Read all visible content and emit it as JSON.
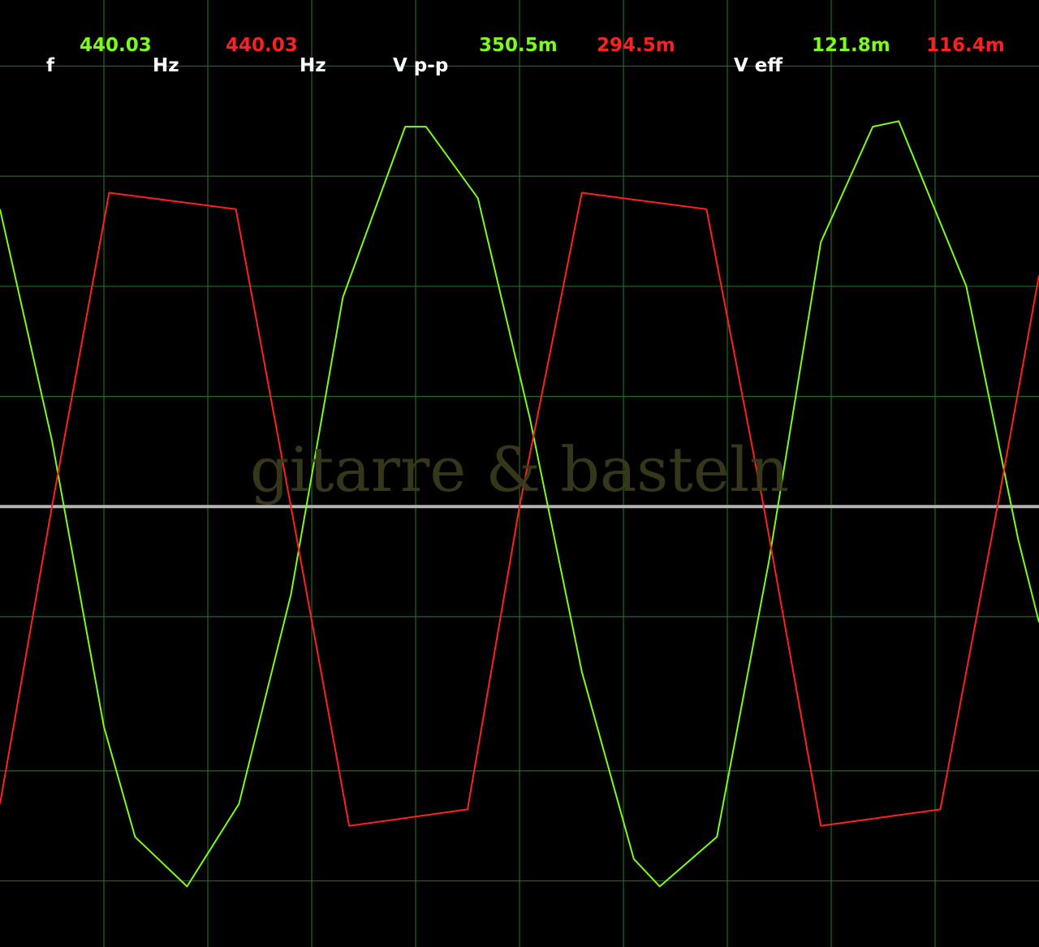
{
  "readouts": {
    "f_label": "f",
    "ch1_freq": "440.03",
    "ch1_unit": "Hz",
    "ch2_freq": "440.03",
    "ch2_unit": "Hz",
    "vpp_label": "V p-p",
    "ch1_vpp": "350.5m",
    "ch2_vpp": "294.5m",
    "veff_label": "V eff",
    "ch1_veff": "121.8m",
    "ch2_veff": "116.4m"
  },
  "watermark": "gitarre & basteln",
  "colors": {
    "background": "#000000",
    "grid": "#1f6a1f",
    "baseline": "#b4b4b4",
    "ch1": "#7cfc1a",
    "ch2": "#ff2020",
    "label": "#ffffff",
    "watermark": "#3c3c1e"
  },
  "chart_data": {
    "type": "line",
    "title": "",
    "xlabel": "",
    "ylabel": "",
    "grid": true,
    "xlim": [
      0,
      10
    ],
    "ylim": [
      -4,
      4.6
    ],
    "x_gridlines": [
      1,
      2,
      3,
      4,
      5,
      6,
      7,
      8,
      9
    ],
    "y_gridlines": [
      -3.4,
      -2.4,
      -1,
      0,
      1,
      2,
      3,
      4
    ],
    "series": [
      {
        "name": "",
        "color": "#7cfc1a",
        "points": [
          [
            0,
            2.7
          ],
          [
            0.5,
            0.6
          ],
          [
            1.0,
            -2.0
          ],
          [
            1.3,
            -3.0
          ],
          [
            1.8,
            -3.45
          ],
          [
            2.3,
            -2.7
          ],
          [
            2.8,
            -0.8
          ],
          [
            3.3,
            1.9
          ],
          [
            3.9,
            3.45
          ],
          [
            4.1,
            3.45
          ],
          [
            4.6,
            2.8
          ],
          [
            5.1,
            0.8
          ],
          [
            5.6,
            -1.5
          ],
          [
            6.1,
            -3.2
          ],
          [
            6.35,
            -3.45
          ],
          [
            6.9,
            -3.0
          ],
          [
            7.4,
            -0.5
          ],
          [
            7.9,
            2.4
          ],
          [
            8.4,
            3.45
          ],
          [
            8.65,
            3.5
          ],
          [
            9.3,
            2.0
          ],
          [
            9.8,
            -0.3
          ],
          [
            10.0,
            -1.05
          ]
        ]
      },
      {
        "name": "",
        "color": "#ff2020",
        "points": [
          [
            0,
            -2.7
          ],
          [
            0.5,
            0.0
          ],
          [
            1.05,
            2.85
          ],
          [
            2.27,
            2.7
          ],
          [
            2.8,
            0.0
          ],
          [
            3.36,
            -2.9
          ],
          [
            4.5,
            -2.75
          ],
          [
            5.0,
            0.0
          ],
          [
            5.6,
            2.85
          ],
          [
            6.8,
            2.7
          ],
          [
            7.35,
            0.0
          ],
          [
            7.9,
            -2.9
          ],
          [
            9.05,
            -2.75
          ],
          [
            9.6,
            0.0
          ],
          [
            10.0,
            2.1
          ]
        ]
      }
    ]
  }
}
